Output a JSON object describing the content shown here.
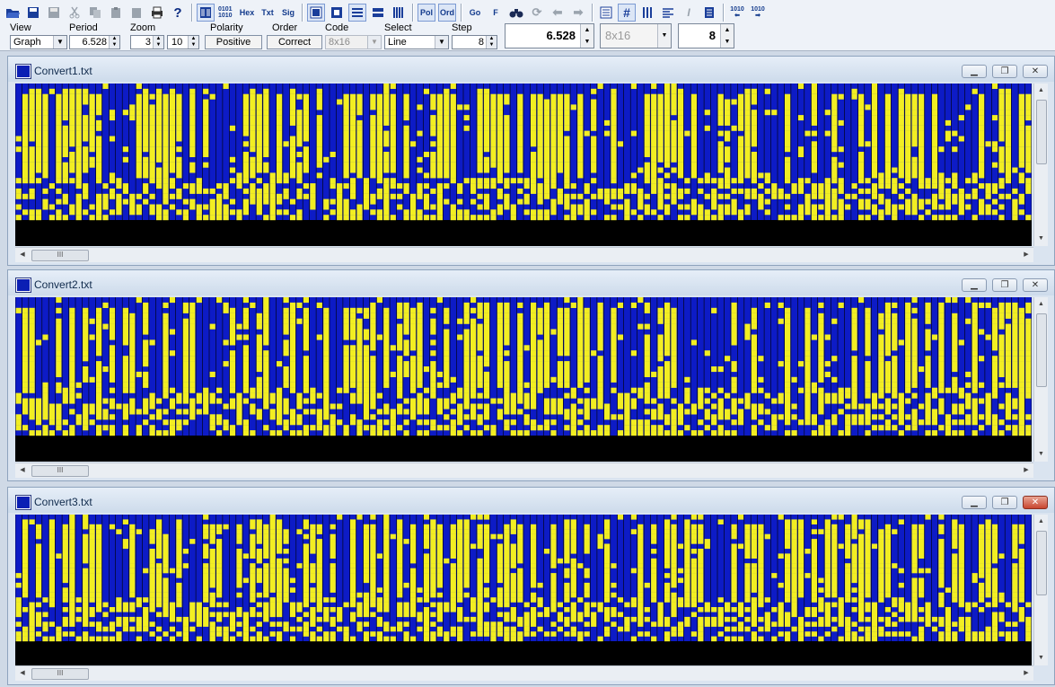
{
  "toolbar": {
    "buttons": [
      "open",
      "save",
      "save-all",
      "cut",
      "copy",
      "paste",
      "paste-special",
      "print",
      "help",
      "view-graph",
      "bin",
      "hex",
      "txt",
      "sig",
      "mode-a",
      "mode-b",
      "align-a",
      "align-b",
      "bars",
      "pol",
      "ord",
      "go",
      "f",
      "find",
      "refresh",
      "back",
      "forward",
      "layout",
      "grid",
      "bars2",
      "lines",
      "italic",
      "page",
      "bits-left",
      "bits-right"
    ],
    "labels": {
      "bin_label": "0101 1010",
      "hex_label": "Hex",
      "txt_label": "Txt",
      "sig_label": "Sig",
      "pol_label": "Pol",
      "ord_label": "Ord",
      "go_label": "Go",
      "f_label": "F",
      "bits_label": "1010"
    },
    "view_label": "View",
    "view_value": "Graph",
    "period_label": "Period",
    "period_value": "6.528",
    "zoom_label": "Zoom",
    "zoom_value": "3",
    "zoom_value2": "10",
    "polarity_label": "Polarity",
    "polarity_value": "Positive",
    "order_label": "Order",
    "order_value": "Correct",
    "code_label": "Code",
    "code_value": "8x16",
    "select_label": "Select",
    "select_value": "Line",
    "step_label": "Step",
    "step_value": "8",
    "big_period": "6.528",
    "big_code": "8x16",
    "big_step": "8",
    "colors": {
      "accent": "#1c2fd6",
      "toolbar_bg": "#eef2f8"
    }
  },
  "windows": [
    {
      "title": "Convert1.txt",
      "active": false
    },
    {
      "title": "Convert2.txt",
      "active": false
    },
    {
      "title": "Convert3.txt",
      "active": true
    }
  ],
  "glyphs": {
    "minimize": "▁",
    "restore": "❐",
    "close": "✕",
    "up": "▲",
    "down": "▼",
    "left": "◀",
    "right": "▶",
    "grip": "III"
  },
  "signal_colors": {
    "bit_on": "#f2ee22",
    "bit_off": "#0d1bc6",
    "grid": "#000000"
  }
}
